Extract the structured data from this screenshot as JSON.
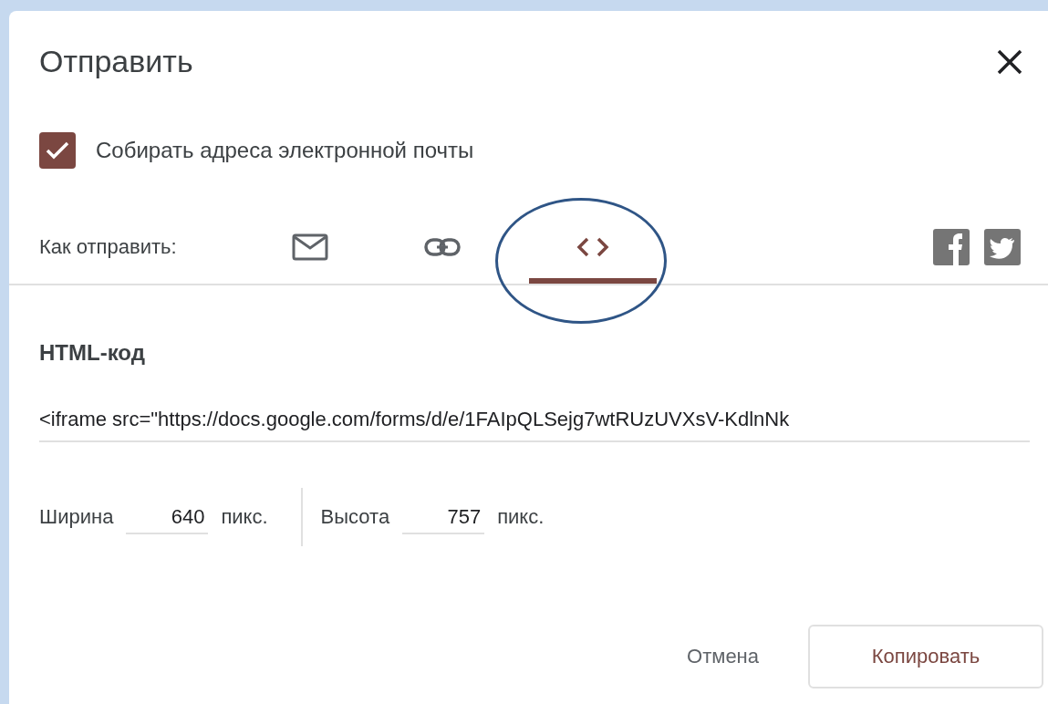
{
  "dialog": {
    "title": "Отправить",
    "collect_emails": {
      "label": "Собирать адреса электронной почты",
      "checked": true
    },
    "send_via": {
      "label": "Как отправить:",
      "tabs": [
        {
          "kind": "email",
          "selected": false
        },
        {
          "kind": "link",
          "selected": false
        },
        {
          "kind": "embed",
          "selected": true
        }
      ],
      "share": [
        {
          "kind": "facebook"
        },
        {
          "kind": "twitter"
        }
      ]
    },
    "html_code": {
      "heading": "HTML-код",
      "value": "<iframe src=\"https://docs.google.com/forms/d/e/1FAIpQLSejg7wtRUzUVXsV-KdlnNk"
    },
    "size": [
      {
        "label": "Ширина",
        "value": "640",
        "unit": "пикс."
      },
      {
        "label": "Высота",
        "value": "757",
        "unit": "пикс."
      }
    ],
    "buttons": [
      {
        "label": "Отмена",
        "kind": "text"
      },
      {
        "label": "Копировать",
        "kind": "outlined"
      }
    ]
  }
}
